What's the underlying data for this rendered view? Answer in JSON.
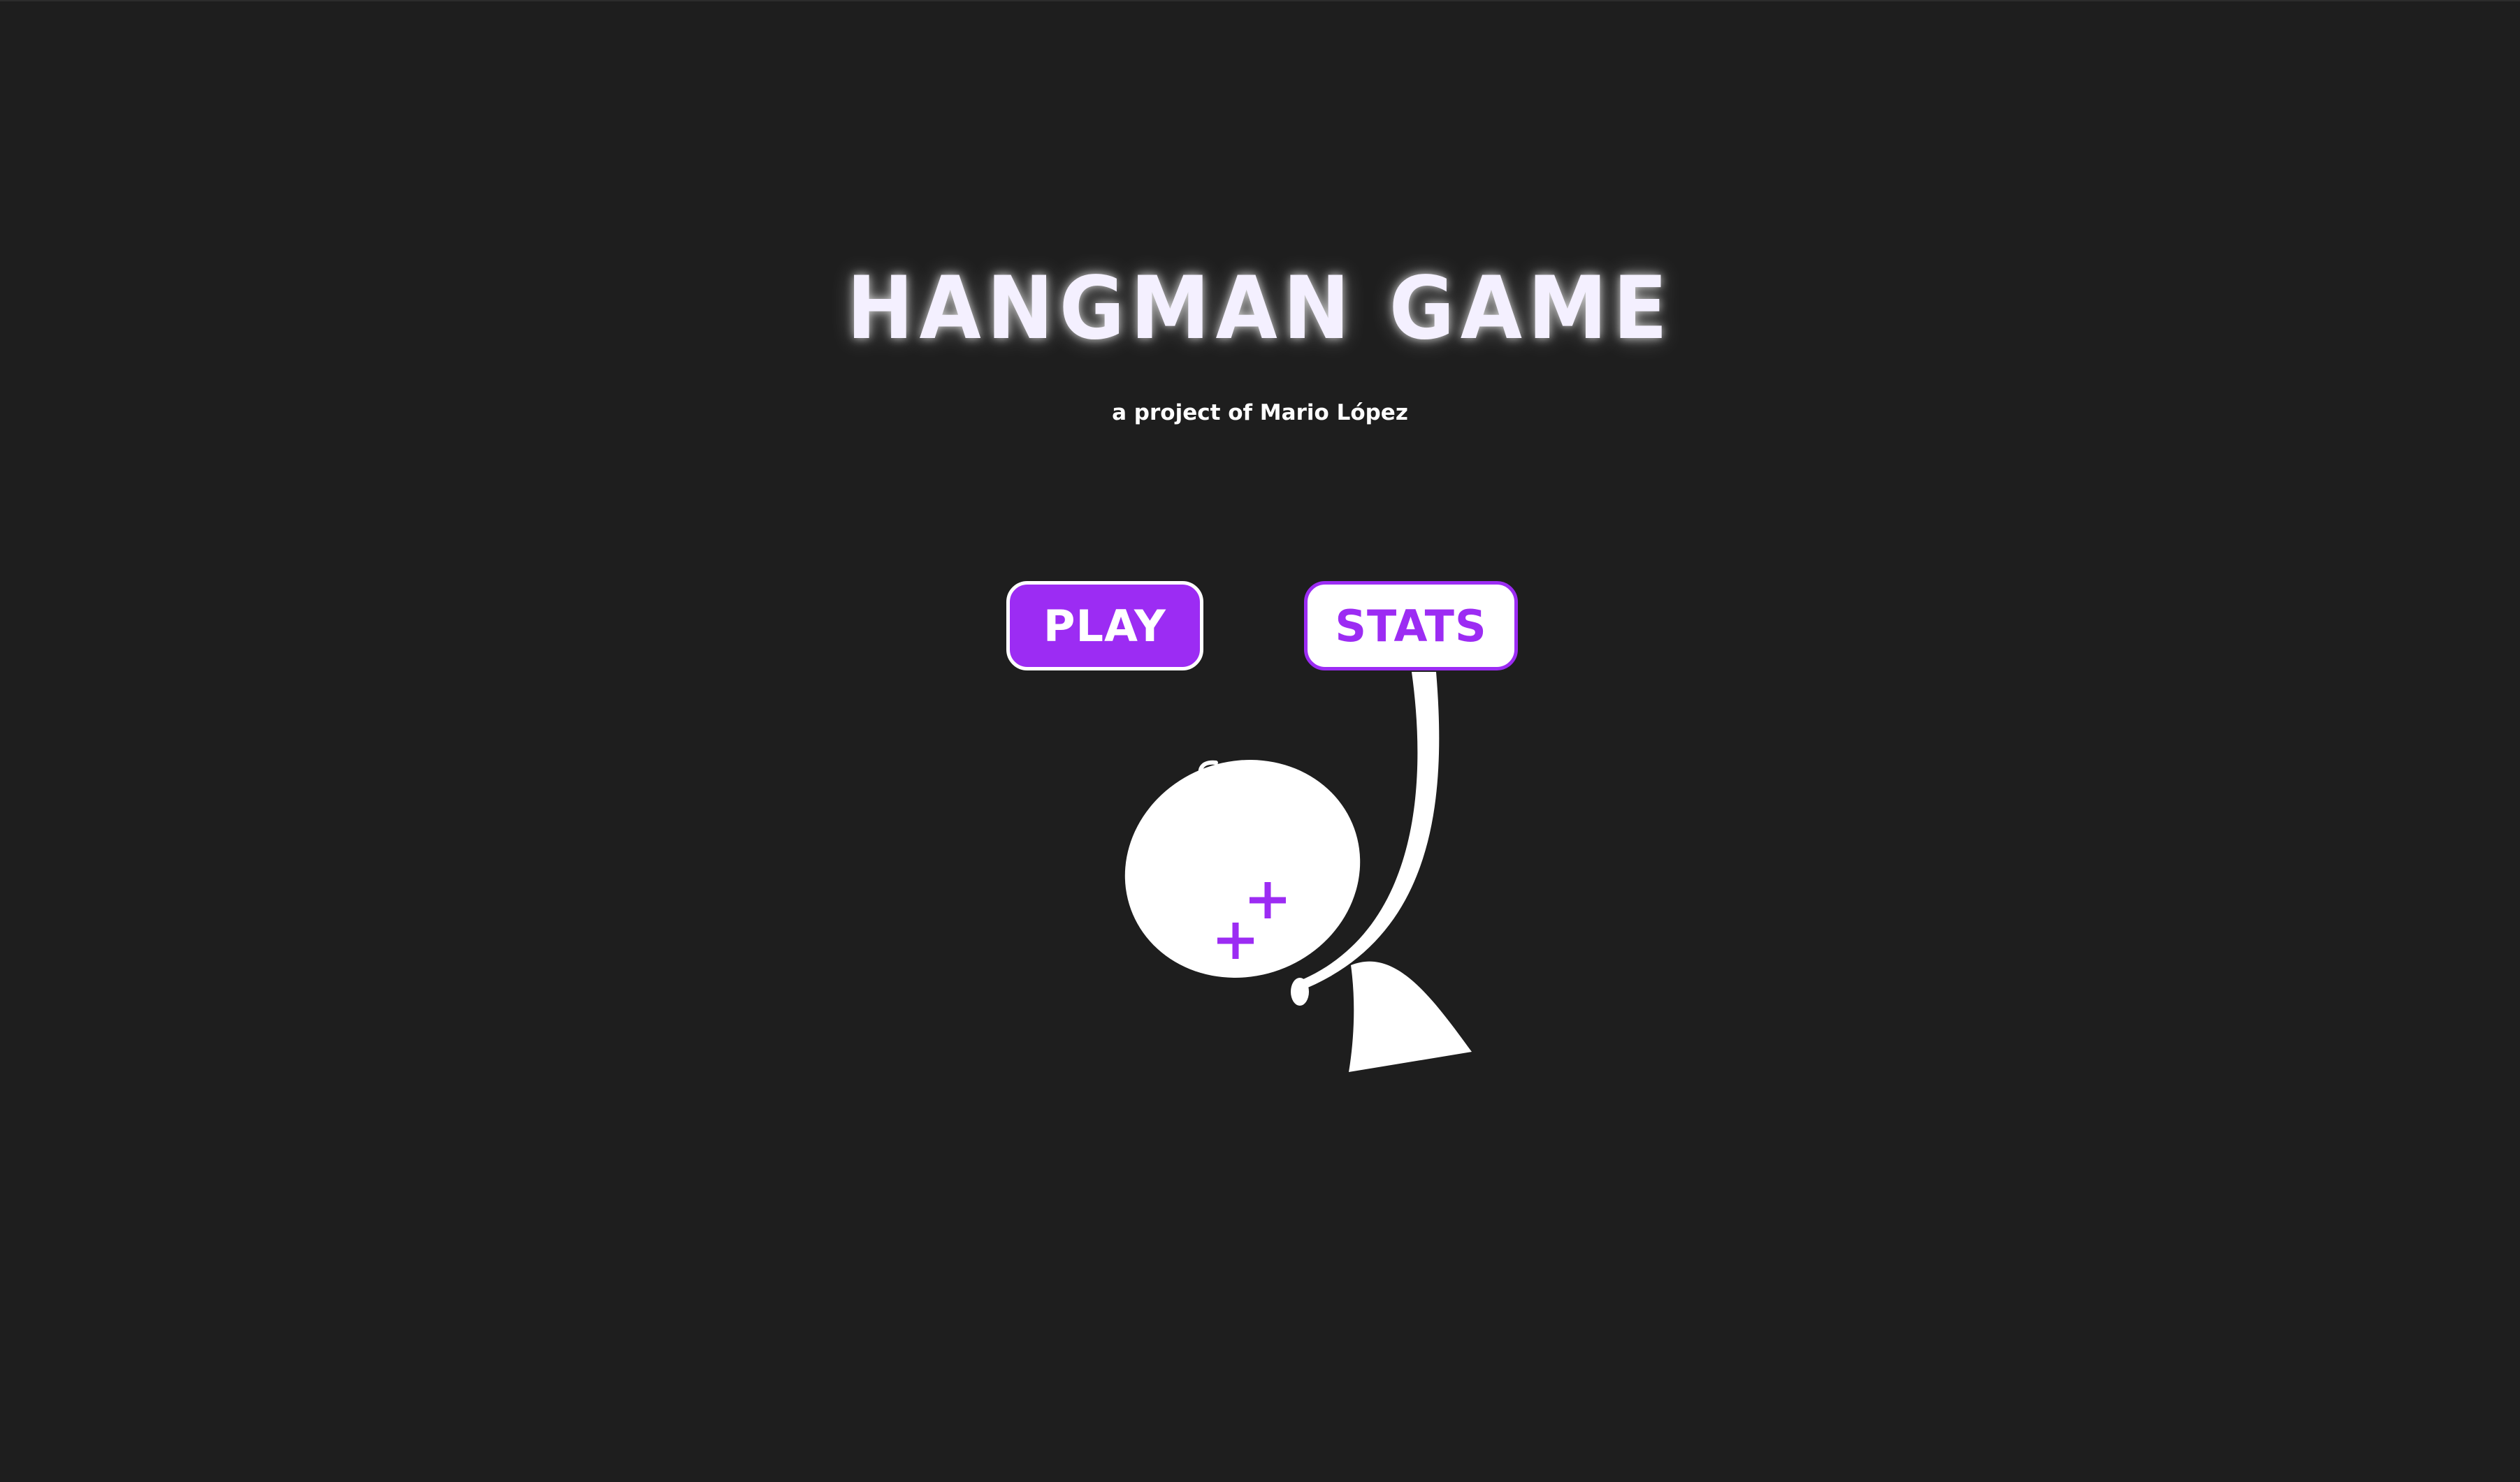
{
  "app": {
    "title": "HANGMAN GAME",
    "subtitle": "a project of Mario López"
  },
  "menu": {
    "play_label": "PLAY",
    "stats_label": "STATS"
  },
  "colors": {
    "background": "#1e1e1e",
    "accent": "#9c2cf3",
    "foreground": "#ffffff"
  },
  "illustration": {
    "icon": "hanged-head-icon",
    "eyes": "dead-cross-eyes"
  }
}
